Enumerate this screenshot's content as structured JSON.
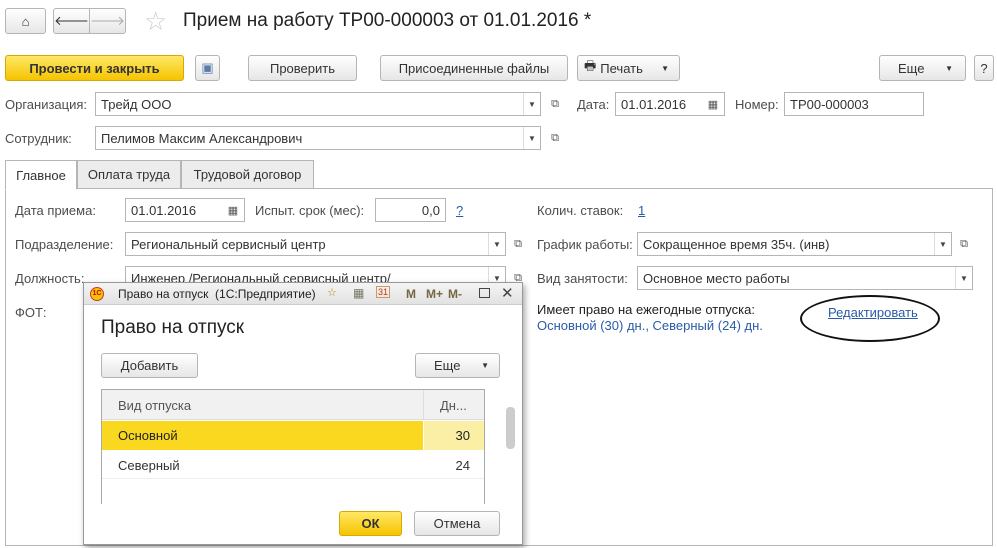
{
  "header": {
    "title": "Прием на работу ТР00-000003 от 01.01.2016 *"
  },
  "toolbar": {
    "post_close": "Провести и закрыть",
    "check": "Проверить",
    "attached": "Присоединенные файлы",
    "print": "Печать",
    "more": "Еще",
    "help": "?"
  },
  "form": {
    "org_label": "Организация:",
    "org_value": "Трейд ООО",
    "date_label": "Дата:",
    "date_value": "01.01.2016",
    "number_label": "Номер:",
    "number_value": "ТР00-000003",
    "employee_label": "Сотрудник:",
    "employee_value": "Пелимов Максим Александрович"
  },
  "tabs": [
    "Главное",
    "Оплата труда",
    "Трудовой договор"
  ],
  "main": {
    "hire_date_label": "Дата приема:",
    "hire_date_value": "01.01.2016",
    "probation_label": "Испыт. срок (мес):",
    "probation_value": "0,0",
    "help": "?",
    "rates_label": "Колич. ставок:",
    "rates_value": "1",
    "dept_label": "Подразделение:",
    "dept_value": "Региональный сервисный центр",
    "schedule_label": "График работы:",
    "schedule_value": "Сокращенное время 35ч. (инв)",
    "position_label": "Должность:",
    "position_value": "Инженер /Региональный сервисный центр/",
    "employment_label": "Вид занятости:",
    "employment_value": "Основное место работы",
    "fot_label": "ФОТ:",
    "vacation_label": "Имеет право на ежегодные отпуска:",
    "vacation_value": "Основной (30) дн., Северный (24) дн.",
    "edit_link": "Редактировать"
  },
  "dialog": {
    "window_title": "Право на отпуск  (1С:Предприятие)",
    "heading": "Право на отпуск",
    "add": "Добавить",
    "more": "Еще",
    "col_type": "Вид отпуска",
    "col_days": "Дн...",
    "rows": [
      {
        "type": "Основной",
        "days": "30"
      },
      {
        "type": "Северный",
        "days": "24"
      }
    ],
    "ok": "ОК",
    "cancel": "Отмена",
    "m": "M",
    "mplus": "M+",
    "mminus": "M-"
  }
}
